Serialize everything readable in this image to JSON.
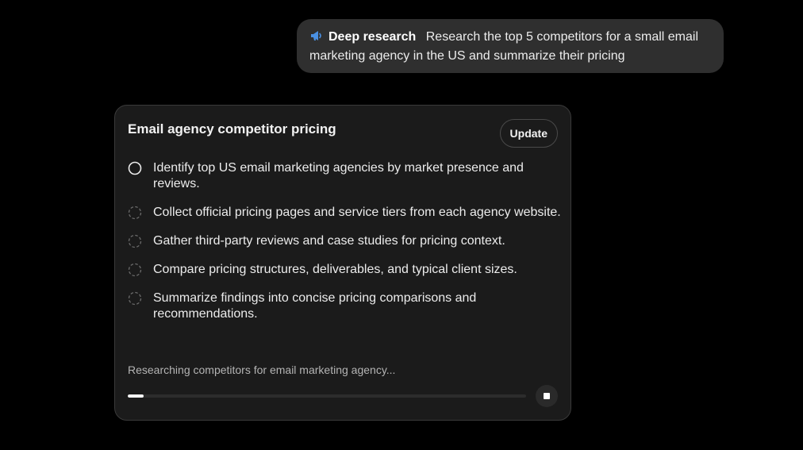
{
  "message": {
    "tool_icon": "megaphone-icon",
    "tool_label": "Deep research",
    "text": "Research the top 5 competitors for a small email marketing agency in the US and summarize their pricing"
  },
  "card": {
    "title": "Email agency competitor pricing",
    "update_label": "Update",
    "steps": [
      {
        "text": "Identify top US email marketing agencies by market presence and reviews.",
        "state": "in-progress",
        "icon": "progress-ring-icon"
      },
      {
        "text": "Collect official pricing pages and service tiers from each agency website.",
        "state": "pending",
        "icon": "pending-circle-icon"
      },
      {
        "text": "Gather third-party reviews and case studies for pricing context.",
        "state": "pending",
        "icon": "pending-circle-icon"
      },
      {
        "text": "Compare pricing structures, deliverables, and typical client sizes.",
        "state": "pending",
        "icon": "pending-circle-icon"
      },
      {
        "text": "Summarize findings into concise pricing comparisons and recommendations.",
        "state": "pending",
        "icon": "pending-circle-icon"
      }
    ],
    "status_text": "Researching competitors for email marketing agency...",
    "progress": 0.04,
    "stop_icon": "stop-icon"
  },
  "colors": {
    "background": "#000000",
    "bubble": "#2f2f2f",
    "card": "#1b1b1b",
    "tool_icon": "#4a90e2",
    "progress_fill": "#f5f5f5"
  }
}
